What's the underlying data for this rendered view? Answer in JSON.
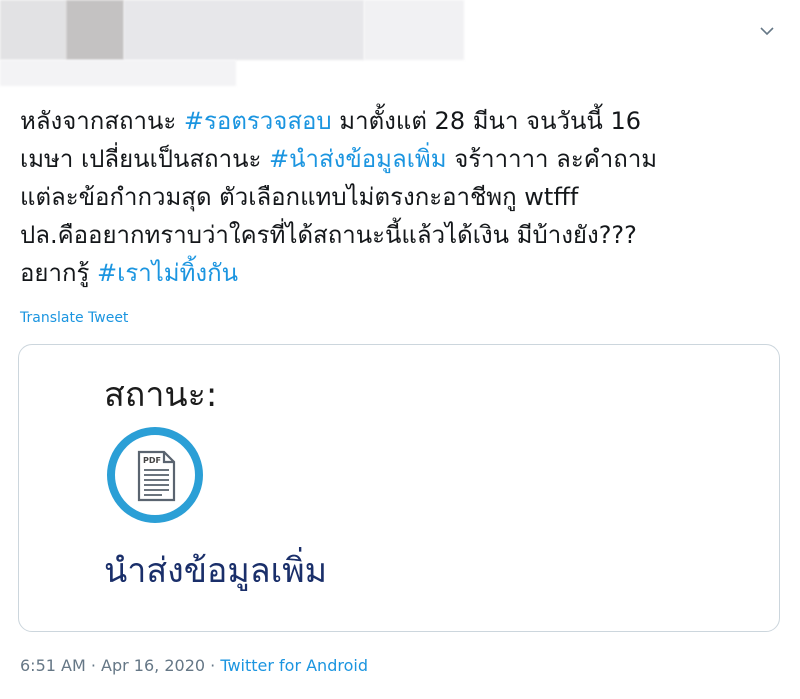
{
  "tweet": {
    "text_parts": [
      {
        "text": "หลังจากสถานะ ",
        "hashtag": false
      },
      {
        "text": "#รอตรวจสอบ",
        "hashtag": true
      },
      {
        "text": " มาตั้งแต่ 28 มีนา จนวันนี้ 16\nเมษา เปลี่ยนเป็นสถานะ ",
        "hashtag": false
      },
      {
        "text": "#นำส่งข้อมูลเพิ่ม",
        "hashtag": true
      },
      {
        "text": " จร้าาาาา ละคำถาม\nแต่ละข้อกำกวมสุด ตัวเลือกแทบไม่ตรงกะอาชีพกู wtfff\nปล.คืออยากทราบว่าใครที่ได้สถานะนี้แล้วได้เงิน มีบ้างยัง???\nอยากรู้ ",
        "hashtag": false
      },
      {
        "text": "#เราไม่ทิ้งกัน",
        "hashtag": true
      }
    ],
    "translate_label": "Translate Tweet"
  },
  "card": {
    "title": "สถานะ:",
    "icon": "pdf-document-icon",
    "icon_label": "PDF",
    "status": "นำส่งข้อมูลเพิ่ม"
  },
  "meta": {
    "time": "6:51 AM",
    "sep1": " · ",
    "date": "Apr 16, 2020",
    "sep2": " · ",
    "source": "Twitter for Android"
  },
  "colors": {
    "link": "#1b95e0",
    "text": "#14171a",
    "muted": "#657786",
    "card_border": "#ccd6dd",
    "icon_ring": "#2b9fd6",
    "status_text": "#1a2f6a"
  }
}
